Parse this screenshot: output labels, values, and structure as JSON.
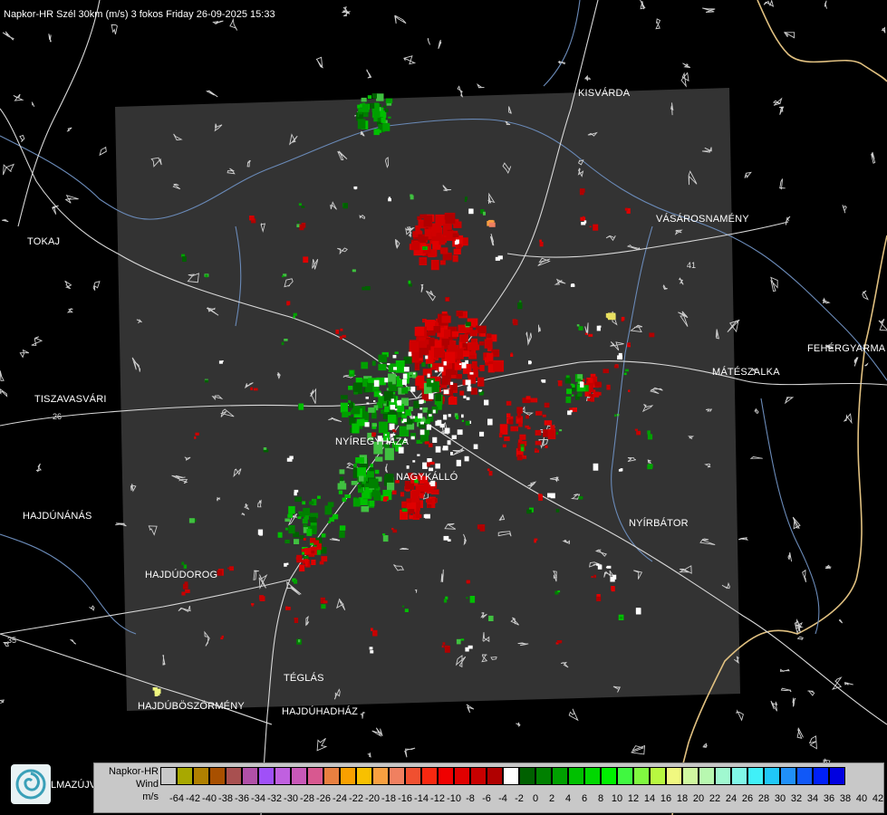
{
  "title": "Napkor-HR Szél 30km (m/s) 3 fokos Friday 26-09-2025 15:33",
  "cities": [
    {
      "id": "kisvarda",
      "name": "KISVÁRDA"
    },
    {
      "id": "tokaj",
      "name": "TOKAJ"
    },
    {
      "id": "vasarosnameny",
      "name": "VÁSÁROSNAMÉNY"
    },
    {
      "id": "fehergyarmat",
      "name": "FEHÉRGYARMA"
    },
    {
      "id": "mateszalka",
      "name": "MÁTÉSZALKA"
    },
    {
      "id": "tiszavasvari",
      "name": "TISZAVASVÁRI"
    },
    {
      "id": "nyiregyhaza",
      "name": "NYÍREGYHÁZA"
    },
    {
      "id": "nagykallo",
      "name": "NAGYKÁLLÓ"
    },
    {
      "id": "nyirbator",
      "name": "NYÍRBÁTOR"
    },
    {
      "id": "hajdunanas",
      "name": "HAJDÚNÁNÁS"
    },
    {
      "id": "hajdudorog",
      "name": "HAJDÚDOROG"
    },
    {
      "id": "teglas",
      "name": "TÉGLÁS"
    },
    {
      "id": "hajduboszormeny",
      "name": "HAJDÚBÖSZÖRMÉNY"
    },
    {
      "id": "hajduhadhaz",
      "name": "HAJDÚHADHÁZ"
    },
    {
      "id": "balmazujvaros",
      "name": "LMAZÚJVÁR"
    }
  ],
  "road_labels": [
    "26",
    "35",
    "41"
  ],
  "legend": {
    "source": "Napkor-HR",
    "variable": "Wind",
    "unit": "m/s",
    "colors": [
      "#c8c8c8",
      "#a8a800",
      "#b08000",
      "#a85000",
      "#a85050",
      "#b050a8",
      "#a050f8",
      "#c060e0",
      "#c858b8",
      "#d85890",
      "#e88040",
      "#f8a000",
      "#f8c000",
      "#f8a040",
      "#f08060",
      "#f05030",
      "#f82810",
      "#f00000",
      "#e00000",
      "#c80000",
      "#b00000",
      "#ffffff",
      "#006000",
      "#008000",
      "#00a000",
      "#00c000",
      "#00d800",
      "#00f000",
      "#40f840",
      "#80f840",
      "#b8f840",
      "#f0f880",
      "#d0f8a0",
      "#b8f8b0",
      "#a0f8d0",
      "#80f8e8",
      "#40f0f8",
      "#20c8f8",
      "#2090f8",
      "#1058f8",
      "#0020f8",
      "#0000e0"
    ],
    "ticks": [
      "-64",
      "-42",
      "-40",
      "-38",
      "-36",
      "-34",
      "-32",
      "-30",
      "-28",
      "-26",
      "-24",
      "-22",
      "-20",
      "-18",
      "-16",
      "-14",
      "-12",
      "-10",
      "-8",
      "-6",
      "-4",
      "-2",
      "0",
      "2",
      "4",
      "6",
      "8",
      "10",
      "12",
      "14",
      "16",
      "18",
      "20",
      "22",
      "24",
      "26",
      "28",
      "30",
      "32",
      "34",
      "36",
      "38",
      "40",
      "42"
    ]
  }
}
